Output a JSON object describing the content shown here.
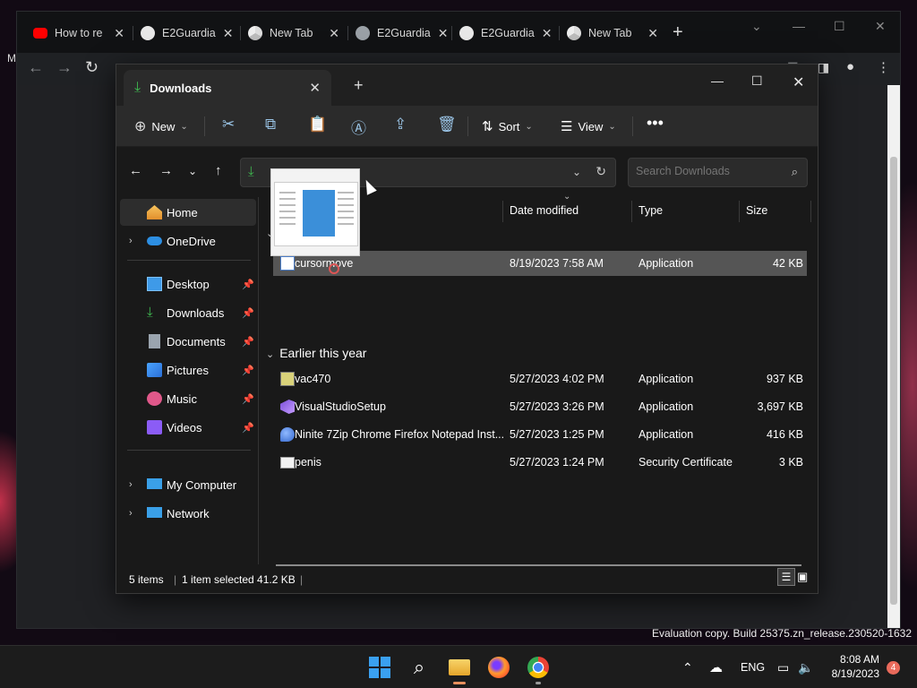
{
  "chrome": {
    "tabs": [
      {
        "label": "How to re",
        "favicon": "youtube-icon",
        "color": "#ff0000"
      },
      {
        "label": "E2Guardia",
        "favicon": "github-icon",
        "color": "#ffffff"
      },
      {
        "label": "New Tab",
        "favicon": "chrome-icon",
        "color": "#ffffff"
      },
      {
        "label": "E2Guardia",
        "favicon": "globe-icon",
        "color": "#9aa0a6"
      },
      {
        "label": "E2Guardia",
        "favicon": "github-icon",
        "color": "#ffffff"
      },
      {
        "label": "New Tab",
        "favicon": "chrome-icon",
        "color": "#ffffff"
      }
    ],
    "left_glyph": "My"
  },
  "explorer": {
    "tab_title": "Downloads",
    "commands": {
      "new": "New",
      "sort": "Sort",
      "view": "View"
    },
    "search_placeholder": "Search Downloads",
    "nav": [
      {
        "label": "Home",
        "icon": "home-icon",
        "selected": true
      },
      {
        "label": "OneDrive",
        "icon": "onedrive-icon",
        "expand": true
      },
      {
        "label": "Desktop",
        "icon": "desktop-icon",
        "pinned": true
      },
      {
        "label": "Downloads",
        "icon": "downloads-icon",
        "pinned": true
      },
      {
        "label": "Documents",
        "icon": "documents-icon",
        "pinned": true
      },
      {
        "label": "Pictures",
        "icon": "pictures-icon",
        "pinned": true
      },
      {
        "label": "Music",
        "icon": "music-icon",
        "pinned": true
      },
      {
        "label": "Videos",
        "icon": "videos-icon",
        "pinned": true
      },
      {
        "label": "My Computer",
        "icon": "computer-icon",
        "expand": true
      },
      {
        "label": "Network",
        "icon": "network-icon",
        "expand": true
      }
    ],
    "columns": {
      "date": "Date modified",
      "type": "Type",
      "size": "Size"
    },
    "groups": {
      "earlier": "Earlier this year"
    },
    "files": [
      {
        "name": "cursormove",
        "date": "8/19/2023 7:58 AM",
        "type": "Application",
        "size": "42 KB",
        "selected": true
      },
      {
        "name": "vac470",
        "date": "5/27/2023 4:02 PM",
        "type": "Application",
        "size": "937 KB"
      },
      {
        "name": "VisualStudioSetup",
        "date": "5/27/2023 3:26 PM",
        "type": "Application",
        "size": "3,697 KB"
      },
      {
        "name": "Ninite 7Zip Chrome Firefox Notepad Inst...",
        "date": "5/27/2023 1:25 PM",
        "type": "Application",
        "size": "416 KB"
      },
      {
        "name": "penis",
        "date": "5/27/2023 1:24 PM",
        "type": "Security Certificate",
        "size": "3 KB"
      }
    ],
    "status": {
      "count": "5 items",
      "selection": "1 item selected  41.2 KB"
    }
  },
  "eval_text": "Evaluation copy. Build 25375.zn_release.230520-1632",
  "taskbar": {
    "lang": "ENG",
    "time": "8:08 AM",
    "date": "8/19/2023",
    "notifications": "4"
  }
}
